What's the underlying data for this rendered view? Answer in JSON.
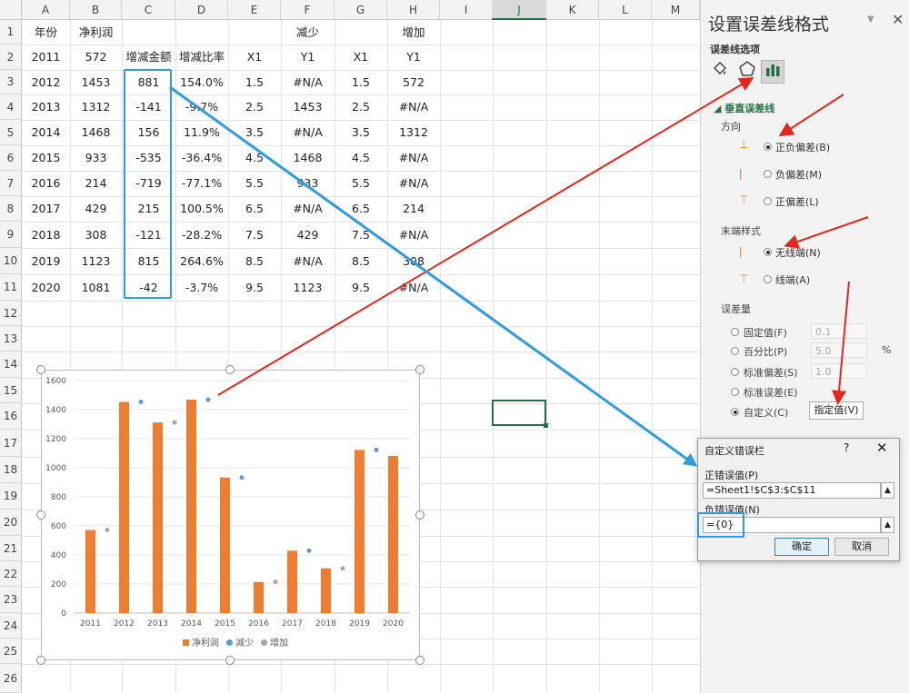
{
  "columns": [
    "A",
    "B",
    "C",
    "D",
    "E",
    "F",
    "G",
    "H",
    "I",
    "J",
    "K",
    "L",
    "M"
  ],
  "rows": [
    "1",
    "2",
    "3",
    "4",
    "5",
    "6",
    "7",
    "8",
    "9",
    "10",
    "11",
    "12",
    "13",
    "14",
    "15",
    "16",
    "17",
    "18",
    "19",
    "20",
    "21",
    "22",
    "23",
    "24",
    "25",
    "26"
  ],
  "table": {
    "row1": [
      "年份",
      "净利润",
      "",
      "",
      "",
      "减少",
      "",
      "增加"
    ],
    "row2": [
      "2011",
      "572",
      "增减金额",
      "增减比率",
      "X1",
      "Y1",
      "X1",
      "Y1"
    ],
    "data": [
      [
        "2012",
        "1453",
        "881",
        "154.0%",
        "1.5",
        "#N/A",
        "1.5",
        "572"
      ],
      [
        "2013",
        "1312",
        "-141",
        "-9.7%",
        "2.5",
        "1453",
        "2.5",
        "#N/A"
      ],
      [
        "2014",
        "1468",
        "156",
        "11.9%",
        "3.5",
        "#N/A",
        "3.5",
        "1312"
      ],
      [
        "2015",
        "933",
        "-535",
        "-36.4%",
        "4.5",
        "1468",
        "4.5",
        "#N/A"
      ],
      [
        "2016",
        "214",
        "-719",
        "-77.1%",
        "5.5",
        "933",
        "5.5",
        "#N/A"
      ],
      [
        "2017",
        "429",
        "215",
        "100.5%",
        "6.5",
        "#N/A",
        "6.5",
        "214"
      ],
      [
        "2018",
        "308",
        "-121",
        "-28.2%",
        "7.5",
        "429",
        "7.5",
        "#N/A"
      ],
      [
        "2019",
        "1123",
        "815",
        "264.6%",
        "8.5",
        "#N/A",
        "8.5",
        "308"
      ],
      [
        "2020",
        "1081",
        "-42",
        "-3.7%",
        "9.5",
        "1123",
        "9.5",
        "#N/A"
      ]
    ]
  },
  "chart_data": {
    "type": "bar",
    "categories": [
      "2011",
      "2012",
      "2013",
      "2014",
      "2015",
      "2016",
      "2017",
      "2018",
      "2019",
      "2020"
    ],
    "ylim": [
      0,
      1600
    ],
    "yticks": [
      "0",
      "200",
      "400",
      "600",
      "800",
      "1000",
      "1200",
      "1400",
      "1600"
    ],
    "series": [
      {
        "name": "净利润",
        "type": "bar",
        "values": [
          572,
          1453,
          1312,
          1468,
          933,
          214,
          429,
          308,
          1123,
          1081
        ]
      },
      {
        "name": "减少",
        "type": "scatter",
        "x": [
          2.5,
          4.5,
          5.5,
          7.5,
          9.5
        ],
        "values": [
          1453,
          1468,
          933,
          429,
          1123
        ]
      },
      {
        "name": "增加",
        "type": "scatter",
        "x": [
          1.5,
          3.5,
          6.5,
          8.5
        ],
        "values": [
          572,
          1312,
          214,
          308
        ]
      }
    ],
    "colors": {
      "bar": "#ed7d31",
      "decrease": "#5b9bd5",
      "increase": "#a5a5a5"
    },
    "legend_position": "bottom"
  },
  "panel": {
    "title": "设置误差线格式",
    "subtitle": "误差线选项",
    "section": "垂直误差线",
    "direction_label": "方向",
    "directions": [
      "正负偏差(B)",
      "负偏差(M)",
      "正偏差(L)"
    ],
    "end_style_label": "末端样式",
    "end_styles": [
      "无线端(N)",
      "线端(A)"
    ],
    "amount_label": "误差量",
    "amounts": [
      "固定值(F)",
      "百分比(P)",
      "标准偏差(S)",
      "标准误差(E)",
      "自定义(C)"
    ],
    "fixed_value": "0.1",
    "percent_value": "5.0",
    "percent_unit": "%",
    "stddev_value": "1.0",
    "specify_button": "指定值(V)"
  },
  "dialog": {
    "title": "自定义错误栏",
    "help": "?",
    "close": "✕",
    "positive_label": "正错误值(P)",
    "positive_value": "=Sheet1!$C$3:$C$11",
    "negative_label": "负错误值(N)",
    "negative_value": "={0}",
    "ok": "确定",
    "cancel": "取消"
  }
}
